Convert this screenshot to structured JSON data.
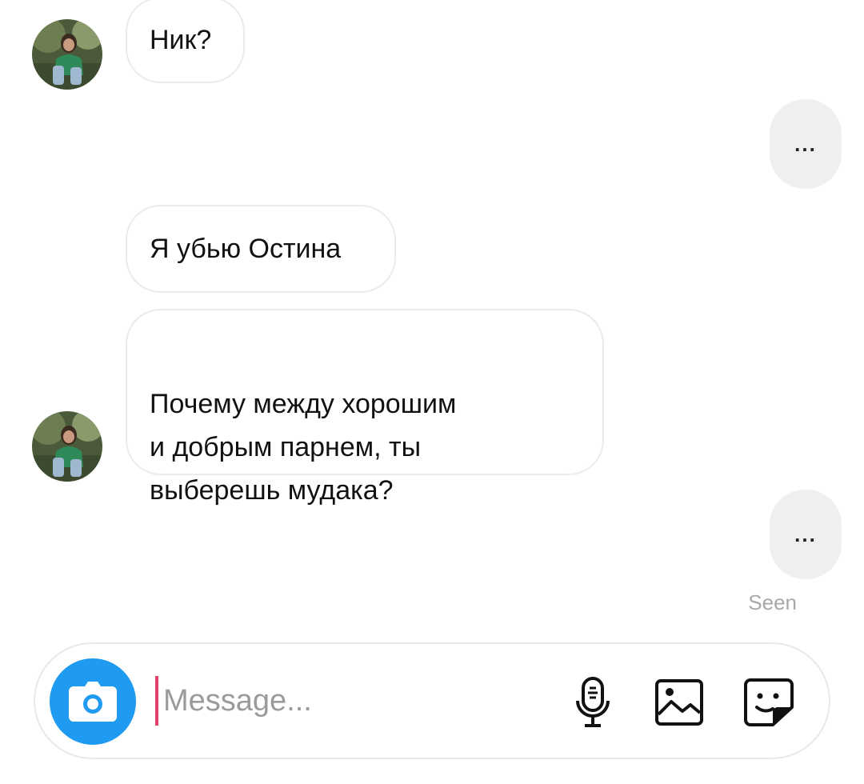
{
  "conversation": {
    "messages": [
      {
        "side": "incoming",
        "text": "Ник?"
      },
      {
        "side": "outgoing",
        "text": "..."
      },
      {
        "side": "incoming",
        "text": "Я убью Остина"
      },
      {
        "side": "incoming",
        "text": "Почему между хорошим\nи добрым парнем, ты\nвыберешь мудака?"
      },
      {
        "side": "outgoing",
        "text": "..."
      }
    ],
    "seen_label": "Seen"
  },
  "composer": {
    "placeholder": "Message...",
    "value": ""
  },
  "icons": {
    "camera": "camera-icon",
    "mic": "microphone-icon",
    "gallery": "image-gallery-icon",
    "sticker": "sticker-icon"
  },
  "colors": {
    "camera_button": "#1e9bf0",
    "outgoing_bubble": "#efefef",
    "incoming_border": "#ebebeb",
    "cursor": "#e2406a",
    "seen_text": "#a8a8a8"
  }
}
